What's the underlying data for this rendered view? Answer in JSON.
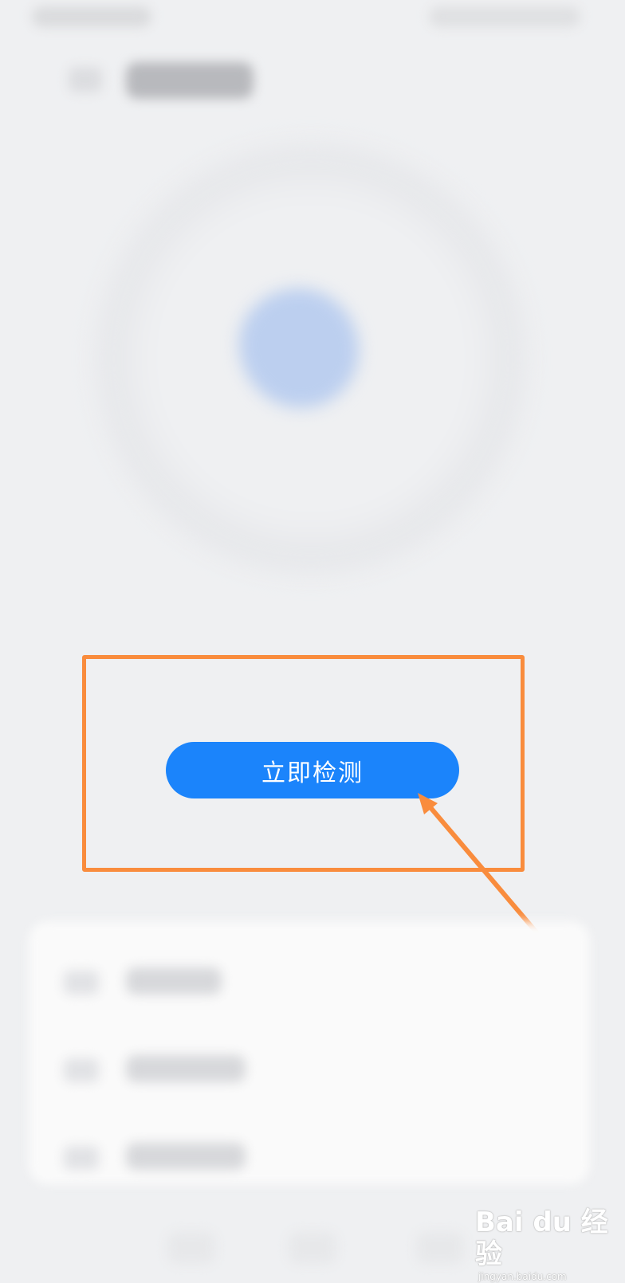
{
  "main": {
    "detect_button_label": "立即检测"
  },
  "annotation": {
    "highlight_color": "#f98c3d"
  },
  "watermark": {
    "logo": "Bai du 经验",
    "url": "jingyan.baidu.com"
  },
  "colors": {
    "accent": "#1b84fb",
    "background": "#eff0f2",
    "scan_icon": "#bccfef"
  }
}
